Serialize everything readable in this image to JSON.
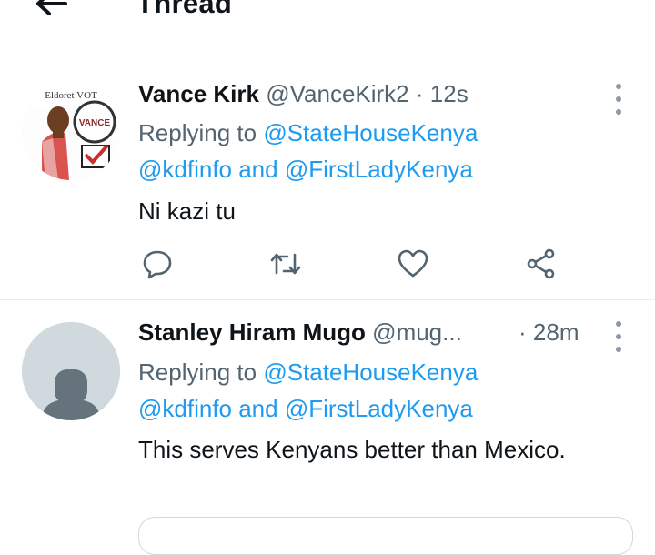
{
  "header": {
    "title": "Thread"
  },
  "tweets": [
    {
      "name": "Vance Kirk",
      "handle": "@VanceKirk2",
      "sep": "·",
      "time": "12s",
      "replying_prefix": "Replying to ",
      "mention1": "@StateHouseKenya",
      "mention2": "@kdfinfo",
      "and": " and ",
      "mention3": "@FirstLadyKenya",
      "text": "Ni kazi tu",
      "avatar_text_top": "Eldoret VOT",
      "avatar_badge": "VANCE"
    },
    {
      "name": "Stanley Hiram Mugo",
      "handle": "@mug...",
      "sep": "·",
      "time": "28m",
      "replying_prefix": "Replying to ",
      "mention1": "@StateHouseKenya",
      "mention2": "@kdfinfo",
      "and": " and ",
      "mention3": "@FirstLadyKenya",
      "text": "This serves Kenyans better than Mexico."
    }
  ],
  "icons": [
    "back-arrow-icon",
    "more-vertical-icon",
    "reply-icon",
    "retweet-icon",
    "like-icon",
    "share-icon"
  ],
  "colors": {
    "mention": "#1d9bf0",
    "secondary": "#536471",
    "divider": "#e6ecf0"
  }
}
